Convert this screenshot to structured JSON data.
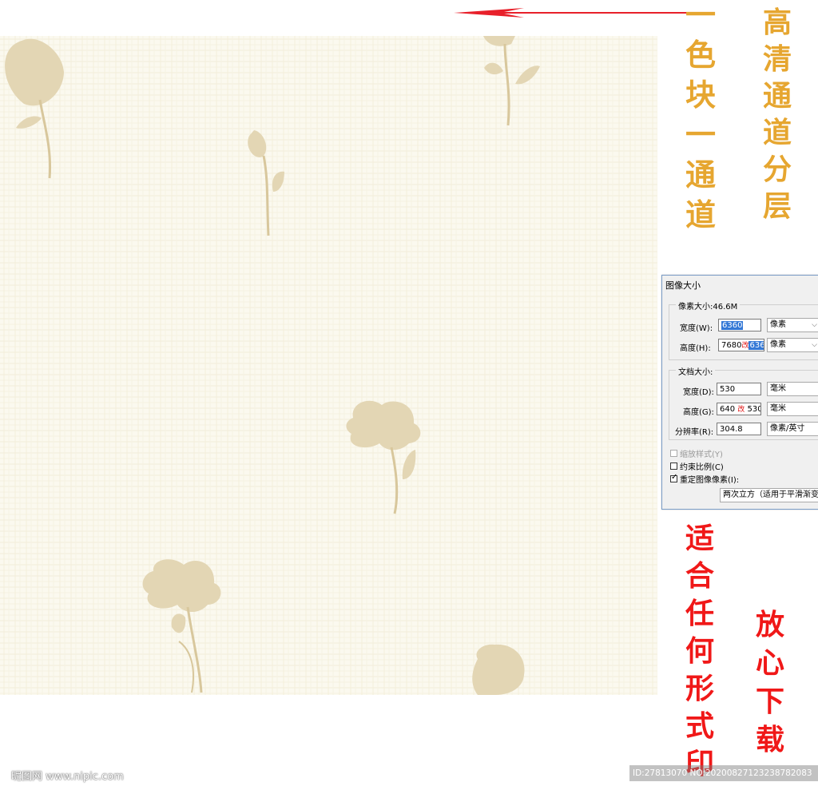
{
  "colors": {
    "swatch_a": "#f6efe0",
    "swatch_b": "#e8ddc0",
    "bg_texture": "#fbf9ef",
    "flower": "#e3d6b4",
    "stem": "#d8c79c",
    "arrow": "#e8202a",
    "gold_text": "#e6a630",
    "red_text": "#f01818"
  },
  "gold_vertical_1": [
    "一",
    "色",
    "块",
    "一",
    "通",
    "道"
  ],
  "gold_vertical_2": [
    "高",
    "清",
    "通",
    "道",
    "分",
    "层"
  ],
  "red_vertical_1": [
    "适",
    "合",
    "任",
    "何",
    "形",
    "式",
    "印"
  ],
  "red_vertical_2": [
    "放",
    "心",
    "下",
    "载"
  ],
  "dialog": {
    "title": "图像大小",
    "pixel_group": {
      "legend": "像素大小:46.6M",
      "width_label": "宽度(W):",
      "width_value": "6360",
      "width_unit": "像素",
      "height_label": "高度(H):",
      "height_value": "7680",
      "height_mark": "改",
      "height_new": "6360",
      "height_unit": "像素"
    },
    "doc_group": {
      "legend": "文档大小:",
      "width_label": "宽度(D):",
      "width_value": "530",
      "width_unit": "毫米",
      "height_label": "高度(G):",
      "height_value": "640",
      "height_mark": "改",
      "height_new": "530",
      "height_unit": "毫米",
      "res_label": "分辨率(R):",
      "res_value": "304.8",
      "res_unit": "像素/英寸"
    },
    "scale_styles": "缩放样式(Y)",
    "constrain": "约束比例(C)",
    "resample": "重定图像像素(I):",
    "resample_method": "两次立方（适用于平滑渐变"
  },
  "watermark": "昵图网 www.nipic.com",
  "id_text": "ID:27813070 NO:20200827123238782083"
}
